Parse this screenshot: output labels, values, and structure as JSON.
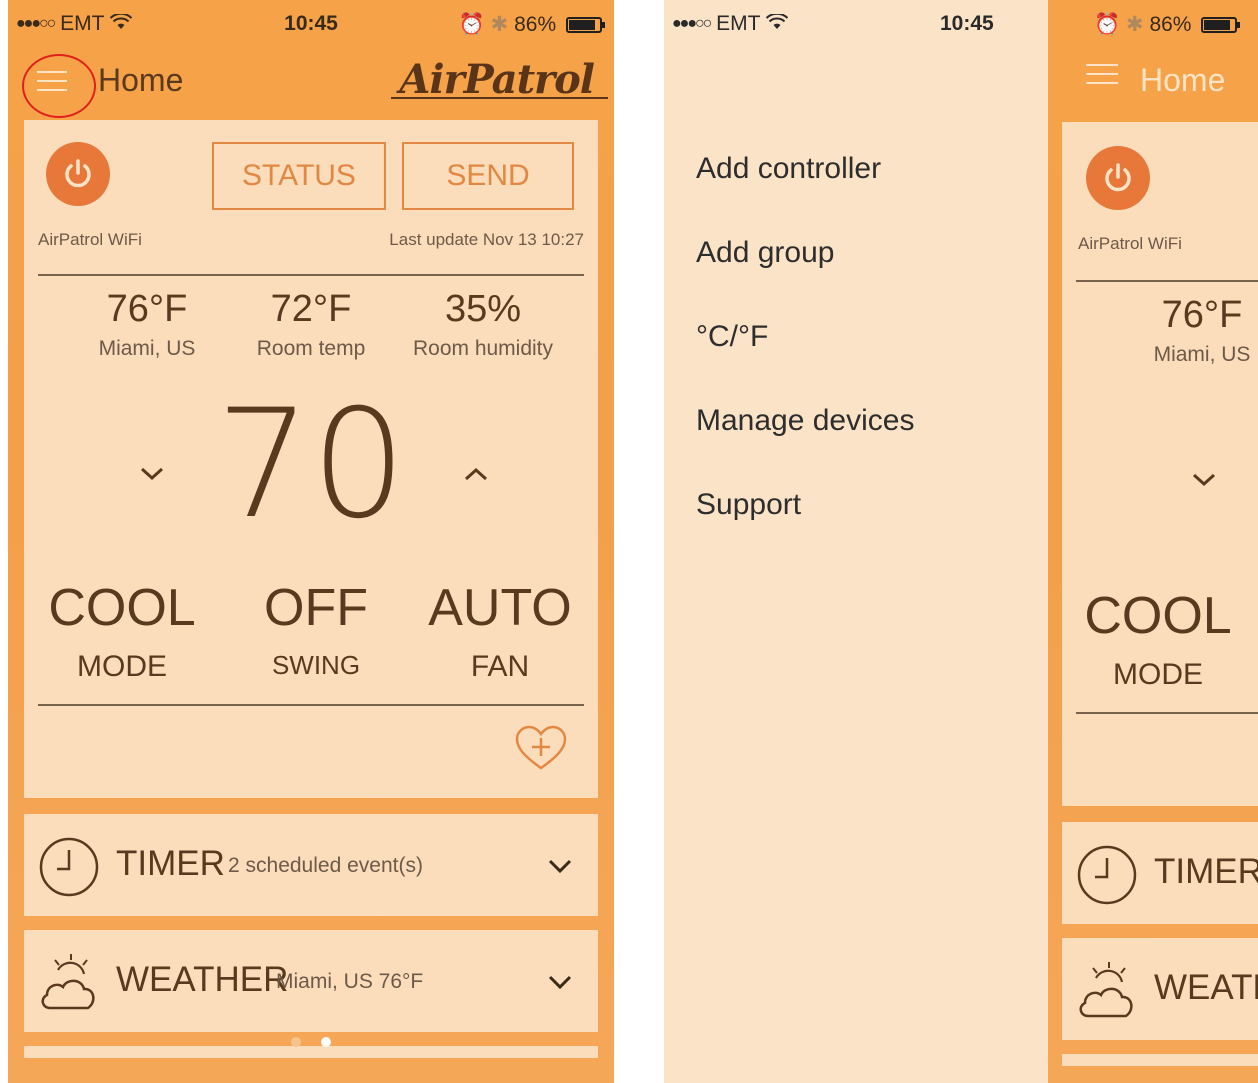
{
  "status_bar": {
    "carrier": "EMT",
    "time": "10:45",
    "battery": "86%"
  },
  "navbar": {
    "title": "Home",
    "logo": "AirPatrol"
  },
  "controller": {
    "status_label": "STATUS",
    "send_label": "SEND",
    "device_name": "AirPatrol WiFi",
    "last_update": "Last update Nov 13 10:27",
    "metrics": [
      {
        "value": "76°F",
        "label": "Miami, US"
      },
      {
        "value": "72°F",
        "label": "Room temp"
      },
      {
        "value": "35%",
        "label": "Room humidity"
      }
    ],
    "setpoint": "70",
    "modes": [
      {
        "value": "COOL",
        "label": "MODE"
      },
      {
        "value": "OFF",
        "label": "SWING"
      },
      {
        "value": "AUTO",
        "label": "FAN"
      }
    ]
  },
  "panels": {
    "timer": {
      "title": "TIMER",
      "subtitle": "2 scheduled event(s)"
    },
    "weather": {
      "title": "WEATHER",
      "subtitle": "Miami, US 76°F"
    }
  },
  "drawer": {
    "items": [
      "Add controller",
      "Add group",
      "°C/°F",
      "Manage devices",
      "Support"
    ]
  },
  "peek": {
    "title": "Home",
    "device_name": "AirPatrol WiFi",
    "metric_value": "76°F",
    "metric_label": "Miami, US",
    "mode_value": "COOL",
    "mode_label": "MODE",
    "timer_title": "TIMER",
    "weather_title": "WEATH"
  },
  "colors": {
    "accent": "#e38842",
    "power": "#e8783a",
    "card": "#fbdcbb",
    "drawer": "#fbe3c7",
    "highlight_ring": "#e0201b"
  },
  "icons": {
    "menu": "hamburger-icon",
    "power": "power-icon",
    "down": "chevron-down-icon",
    "up": "chevron-up-icon",
    "favorite": "heart-plus-icon",
    "timer": "clock-icon",
    "weather": "cloud-sun-icon"
  }
}
